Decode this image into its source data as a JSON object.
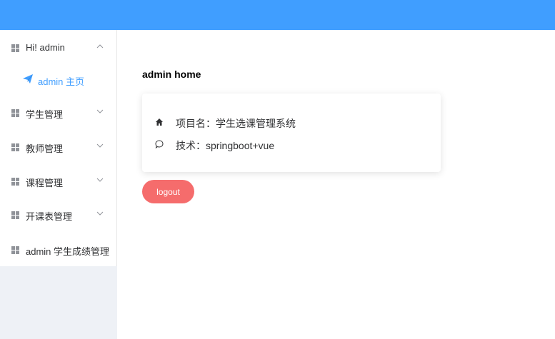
{
  "colors": {
    "accent": "#409eff",
    "danger": "#f56c6c",
    "icon_gray": "#909399"
  },
  "sidebar": {
    "items": [
      {
        "label": "Hi! admin",
        "icon": "grid-icon",
        "chevron": "chevron-up-icon",
        "children": [
          {
            "label": "admin 主页",
            "icon": "paper-plane-icon",
            "active": true
          }
        ]
      },
      {
        "label": "学生管理",
        "icon": "grid-icon",
        "chevron": "chevron-down-icon"
      },
      {
        "label": "教师管理",
        "icon": "grid-icon",
        "chevron": "chevron-down-icon"
      },
      {
        "label": "课程管理",
        "icon": "grid-icon",
        "chevron": "chevron-down-icon"
      },
      {
        "label": "开课表管理",
        "icon": "grid-icon",
        "chevron": "chevron-down-icon"
      },
      {
        "label": "admin 学生成绩管理",
        "icon": "grid-icon"
      }
    ]
  },
  "main": {
    "title": "admin home",
    "info": [
      {
        "icon": "home-icon",
        "text": "项目名：学生选课管理系统"
      },
      {
        "icon": "chat-bubble-icon",
        "text": "技术：springboot+vue"
      }
    ],
    "logout_label": "logout"
  }
}
